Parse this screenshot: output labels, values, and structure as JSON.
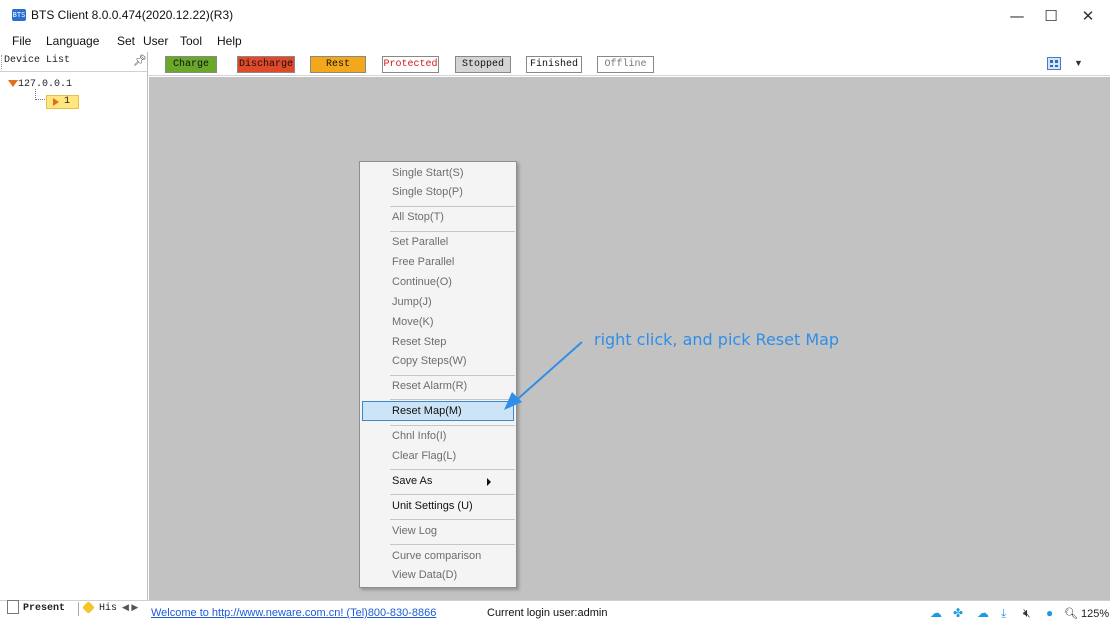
{
  "window": {
    "title": "BTS Client 8.0.0.474(2020.12.22)(R3)",
    "app_icon_text": "BTS",
    "minimize": "—",
    "maximize": "☐",
    "close": "✕"
  },
  "menubar": {
    "items": [
      "File",
      "Language",
      "Set",
      "User",
      "Tool",
      "Help"
    ]
  },
  "sidebar": {
    "title": "Device List",
    "pin": "📌",
    "tree": {
      "host": "127.0.0.1",
      "unit": "1"
    }
  },
  "legend": {
    "items": [
      {
        "label": "Charge",
        "bg": "#6aa82a",
        "color": "#111111"
      },
      {
        "label": "Discharge",
        "bg": "#e0492a",
        "color": "#111111"
      },
      {
        "label": "Rest",
        "bg": "#f2a81a",
        "color": "#111111"
      },
      {
        "label": "Protected",
        "bg": "#ffffff",
        "color": "#d01818"
      },
      {
        "label": "Stopped",
        "bg": "#d4d4d4",
        "color": "#111111"
      },
      {
        "label": "Finished",
        "bg": "#ffffff",
        "color": "#111111"
      },
      {
        "label": "Offline",
        "bg": "#ffffff",
        "color": "#777777"
      }
    ]
  },
  "context_menu": {
    "items": [
      {
        "label": "Single Start(S)"
      },
      {
        "label": "Single Stop(P)"
      },
      {
        "label": "All Stop(T)"
      },
      {
        "label": "Set Parallel"
      },
      {
        "label": "Free Parallel"
      },
      {
        "label": "Continue(O)"
      },
      {
        "label": "Jump(J)"
      },
      {
        "label": "Move(K)"
      },
      {
        "label": "Reset Step"
      },
      {
        "label": "Copy Steps(W)"
      },
      {
        "label": "Reset Alarm(R)"
      },
      {
        "label": "Reset Map(M)"
      },
      {
        "label": "Chnl Info(I)"
      },
      {
        "label": "Clear Flag(L)"
      },
      {
        "label": "Save As"
      },
      {
        "label": "Unit Settings (U)"
      },
      {
        "label": "View Log"
      },
      {
        "label": "Curve comparison"
      },
      {
        "label": "View Data(D)"
      }
    ],
    "highlighted": "Reset Map(M)"
  },
  "annotation": "right click, and pick Reset Map",
  "bottom": {
    "tab_present": "Present",
    "tab_his": "His",
    "tab_nav": "◀ ▶",
    "welcome": "Welcome to http://www.neware.com.cn! (Tel)800-830-8866",
    "login": "Current login user:admin",
    "zoom": "125%",
    "accent": "#1d5bd6"
  }
}
